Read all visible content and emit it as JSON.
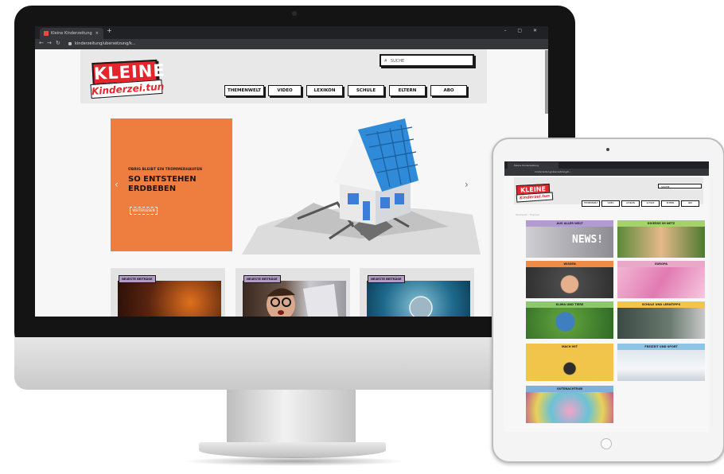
{
  "desktop": {
    "browser": {
      "tab_title": "Kleine Kinderzeitung",
      "new_tab_symbol": "+",
      "close_symbol": "×",
      "window_controls": "– ▢ ✕",
      "url": "kinderzeitung/ubersetzung/k..."
    },
    "site": {
      "logo_main": "KLEINE",
      "logo_sub": "Kinderzei.tun",
      "search_placeholder": "SUCHE",
      "nav": [
        "THEMENWELT",
        "VIDEO",
        "LEXIKON",
        "SCHULE",
        "ELTERN",
        "ABO"
      ]
    },
    "hero": {
      "kicker": "ÜBRIG BLEIBT EIN TRÜMMERHAUFEN",
      "title_line1": "SO ENTSTEHEN",
      "title_line2": "ERDBEBEN",
      "button": "WEITERLESEN",
      "prev_arrow": "‹",
      "next_arrow": "›"
    },
    "cards": [
      {
        "badge": "NEUESTE BEITRÄGE"
      },
      {
        "badge": "NEUESTE BEITRÄGE"
      },
      {
        "badge": "NEUESTE BEITRÄGE"
      }
    ]
  },
  "tablet": {
    "browser": {
      "tab_title": "Kleine Kinderzeitung",
      "url": "kinderzeitung/ubersetzung/k..."
    },
    "site": {
      "logo_main": "KLEINE",
      "logo_sub": "Kinderzei.tun",
      "search_placeholder": "SUCHE",
      "nav": [
        "THEMENWELT",
        "VIDEO",
        "LEXIKON",
        "SCHULE",
        "ELTERN",
        "ABO"
      ],
      "breadcrumb": "Startseite › Themen"
    },
    "tiles": [
      {
        "label": "AUS ALLER WELT",
        "color": "#b39bd1",
        "img_text": "NEWS!"
      },
      {
        "label": "DIVERSE IM NETZ",
        "color": "#a7d26a",
        "img_text": ""
      },
      {
        "label": "WISSEN",
        "color": "#ef8b45",
        "img_text": ""
      },
      {
        "label": "EUROPA",
        "color": "#e8a9c9",
        "img_text": ""
      },
      {
        "label": "KLIMA UND TIERE",
        "color": "#8dc96b",
        "img_text": ""
      },
      {
        "label": "SCHULE UND LERNTIPPS",
        "color": "#f1c64a",
        "img_text": ""
      },
      {
        "label": "MACH MIT",
        "color": "#f4c24b",
        "img_text": ""
      },
      {
        "label": "FREIZEIT UND SPORT",
        "color": "#8fc5e4",
        "img_text": ""
      },
      {
        "label": "GUTENACHTRUB",
        "color": "#7fb1d8",
        "img_text": ""
      }
    ]
  }
}
